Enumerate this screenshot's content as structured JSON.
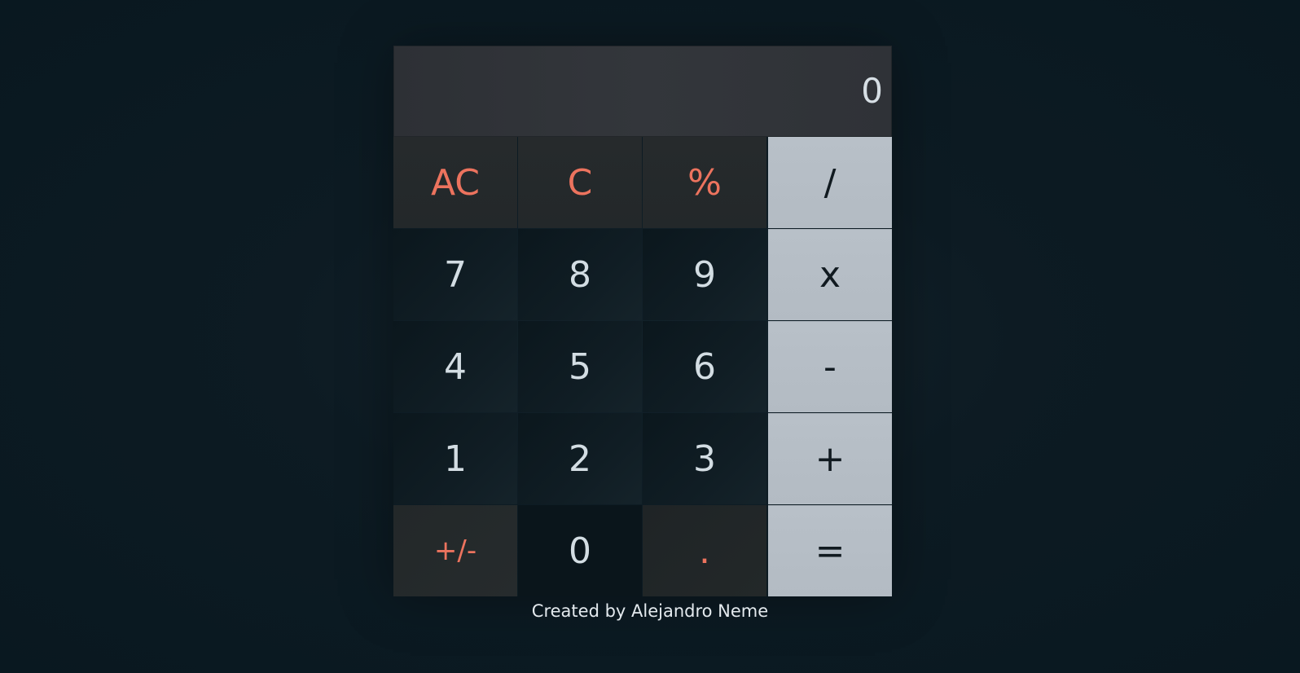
{
  "display": {
    "value": "0"
  },
  "keys": {
    "ac": "AC",
    "c": "C",
    "percent": "%",
    "divide": "/",
    "seven": "7",
    "eight": "8",
    "nine": "9",
    "multiply": "x",
    "four": "4",
    "five": "5",
    "six": "6",
    "minus": "-",
    "one": "1",
    "two": "2",
    "three": "3",
    "plus": "+",
    "sign": "+/-",
    "zero": "0",
    "dot": ".",
    "equals": "="
  },
  "footer": {
    "credit": "Created by Alejandro Neme"
  },
  "colors": {
    "accent": "#ec735e",
    "operator_bg": "#b8c0c8",
    "display_bg": "#33363b",
    "page_bg": "#091820"
  }
}
